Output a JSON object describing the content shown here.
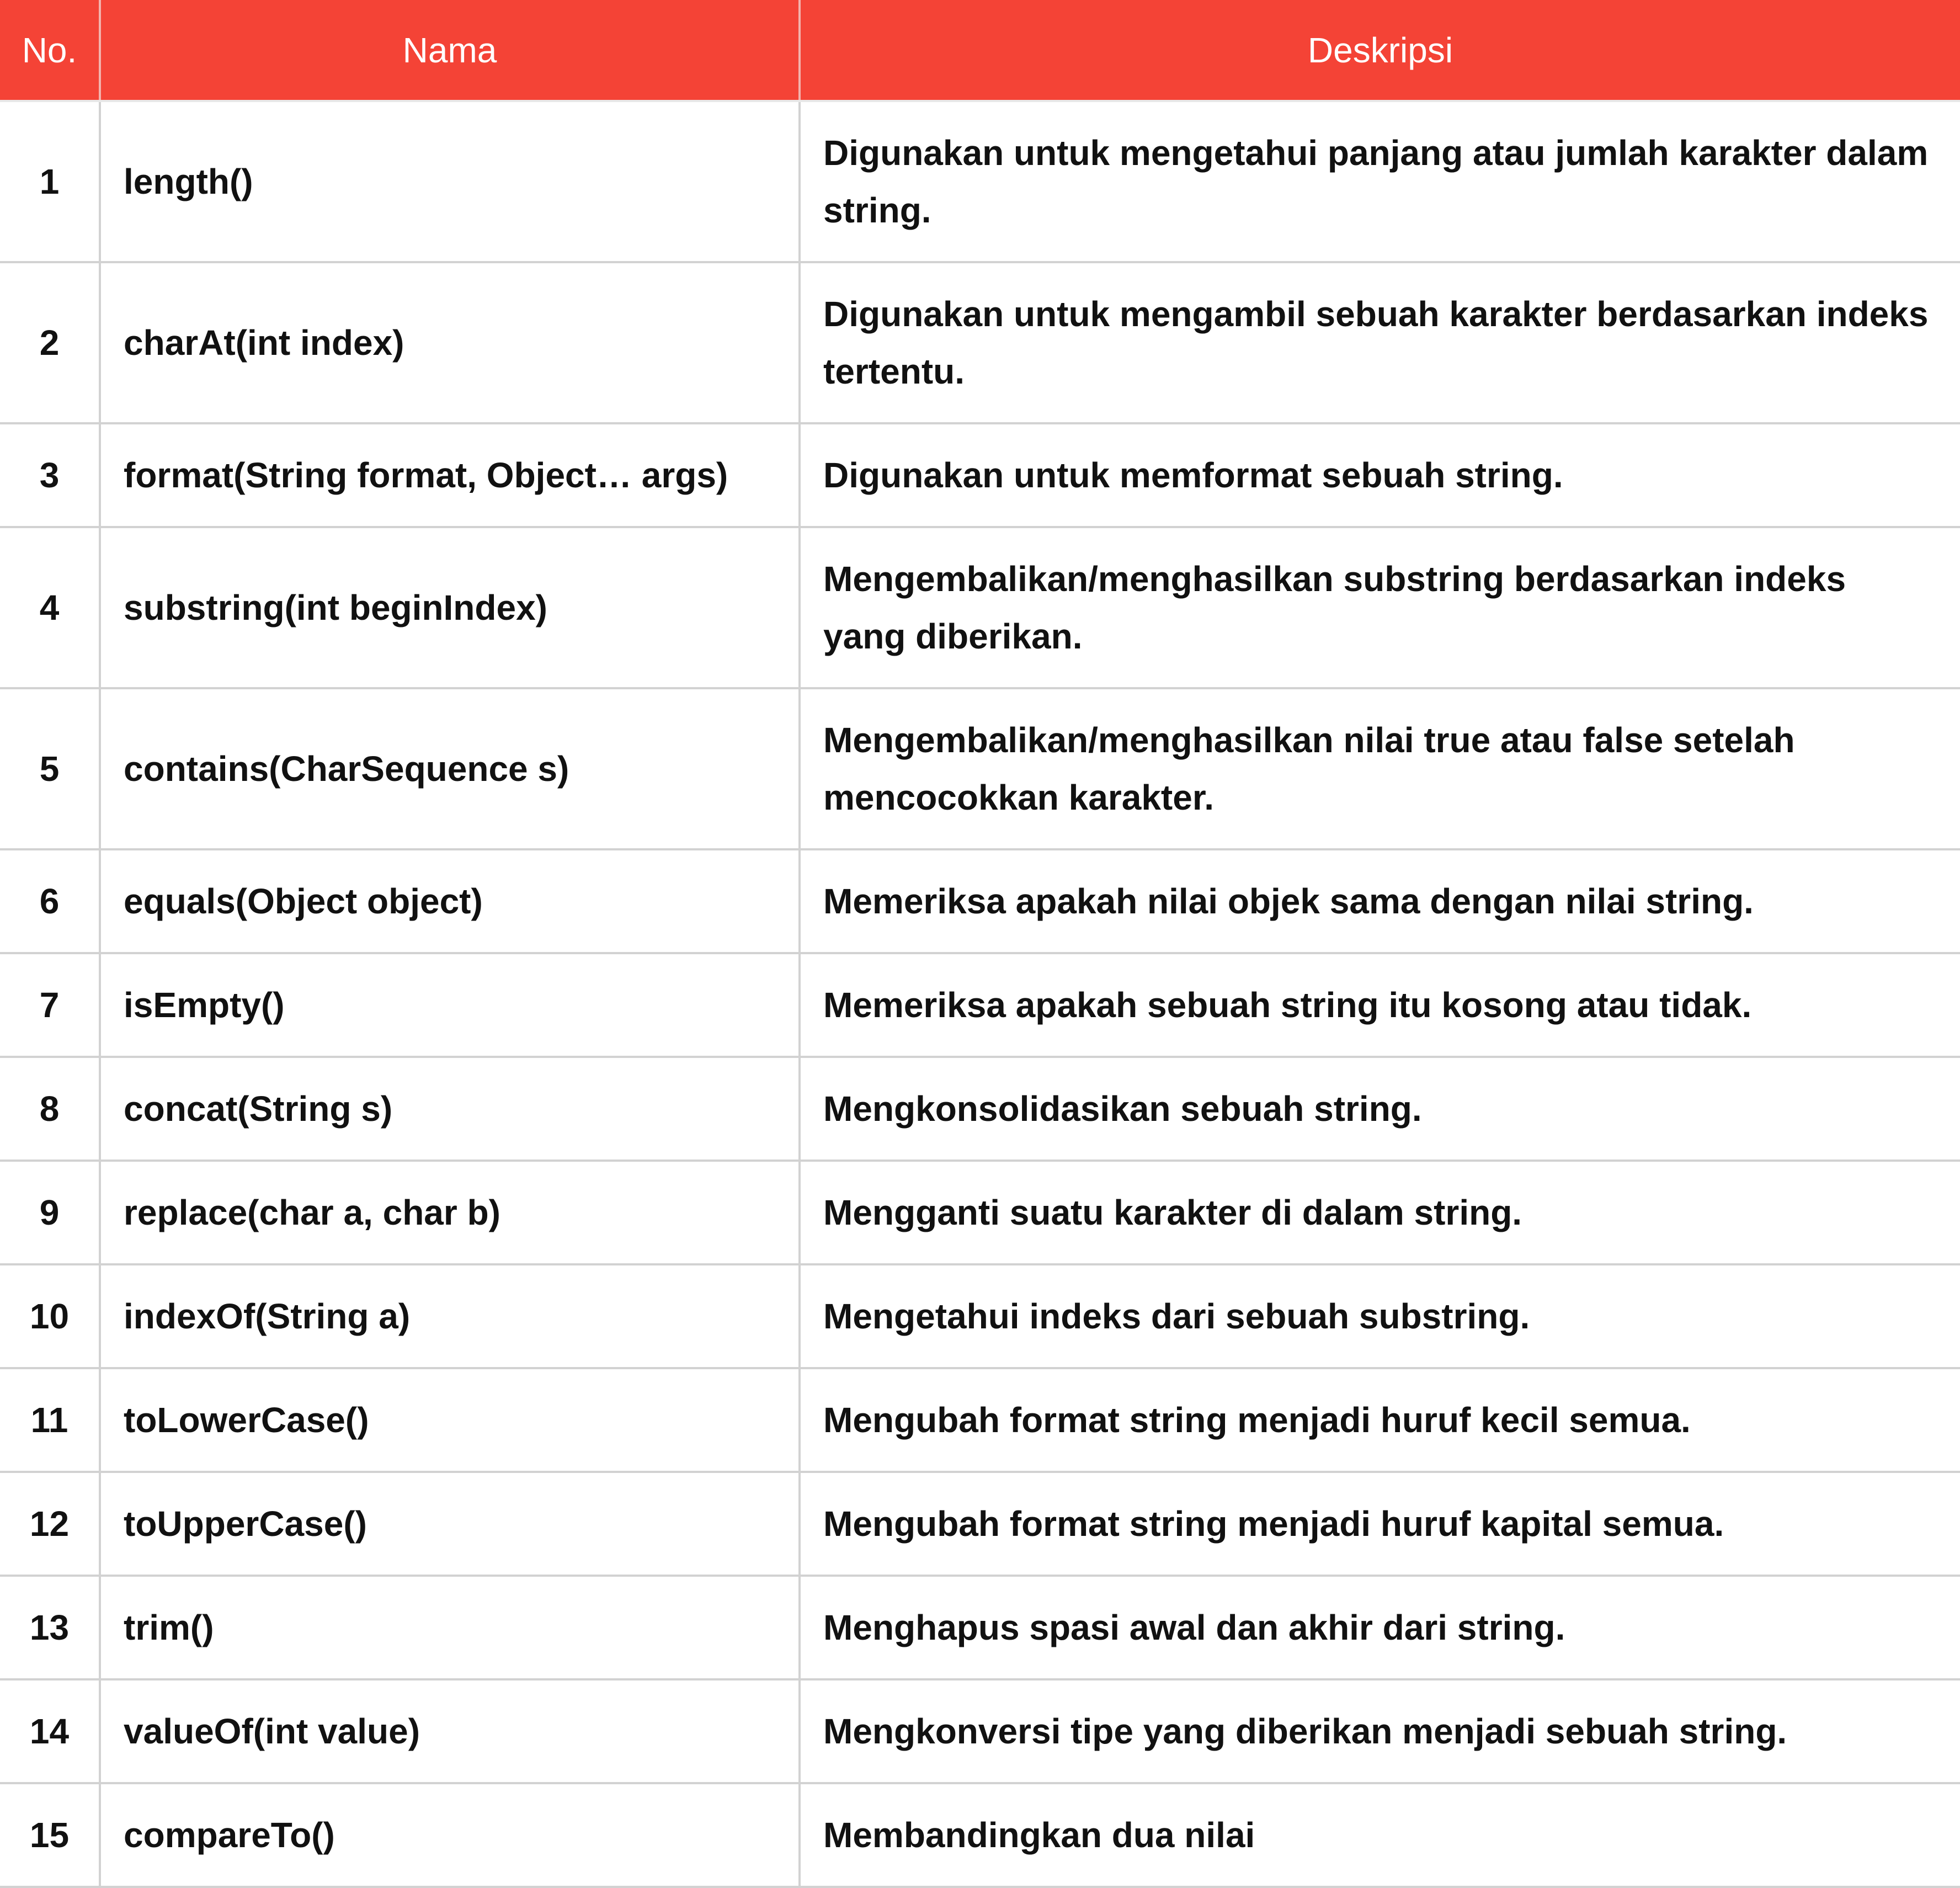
{
  "table": {
    "headers": {
      "no": "No.",
      "nama": "Nama",
      "deskripsi": "Deskripsi"
    },
    "rows": [
      {
        "no": "1",
        "nama": "length()",
        "deskripsi": "Digunakan untuk mengetahui panjang atau jumlah karakter dalam string."
      },
      {
        "no": "2",
        "nama": "charAt(int index)",
        "deskripsi": "Digunakan untuk mengambil sebuah karakter berdasarkan indeks tertentu."
      },
      {
        "no": "3",
        "nama": "format(String format, Object… args)",
        "deskripsi": "Digunakan untuk memformat sebuah string."
      },
      {
        "no": "4",
        "nama": "substring(int beginIndex)",
        "deskripsi": "Mengembalikan/menghasilkan substring berdasarkan indeks yang diberikan."
      },
      {
        "no": "5",
        "nama": "contains(CharSequence s)",
        "deskripsi": "Mengembalikan/menghasilkan nilai true atau false setelah mencocokkan karakter."
      },
      {
        "no": "6",
        "nama": "equals(Object object)",
        "deskripsi": "Memeriksa apakah nilai objek sama dengan nilai string."
      },
      {
        "no": "7",
        "nama": "isEmpty()",
        "deskripsi": "Memeriksa apakah sebuah string itu kosong atau tidak."
      },
      {
        "no": "8",
        "nama": "concat(String s)",
        "deskripsi": "Mengkonsolidasikan sebuah string."
      },
      {
        "no": "9",
        "nama": "replace(char a, char b)",
        "deskripsi": "Mengganti suatu karakter di dalam string."
      },
      {
        "no": "10",
        "nama": "indexOf(String a)",
        "deskripsi": "Mengetahui indeks dari sebuah substring."
      },
      {
        "no": "11",
        "nama": "toLowerCase()",
        "deskripsi": "Mengubah format string menjadi huruf kecil semua."
      },
      {
        "no": "12",
        "nama": "toUpperCase()",
        "deskripsi": "Mengubah format string menjadi huruf kapital semua."
      },
      {
        "no": "13",
        "nama": "trim()",
        "deskripsi": "Menghapus spasi awal dan akhir dari string."
      },
      {
        "no": "14",
        "nama": "valueOf(int value)",
        "deskripsi": "Mengkonversi tipe yang diberikan menjadi sebuah string."
      },
      {
        "no": "15",
        "nama": "compareTo()",
        "deskripsi": "Membandingkan dua nilai"
      }
    ]
  },
  "colors": {
    "header_background": "#f44336",
    "header_text": "#ffffff",
    "border": "#d2d2d2",
    "body_text": "#111111"
  }
}
